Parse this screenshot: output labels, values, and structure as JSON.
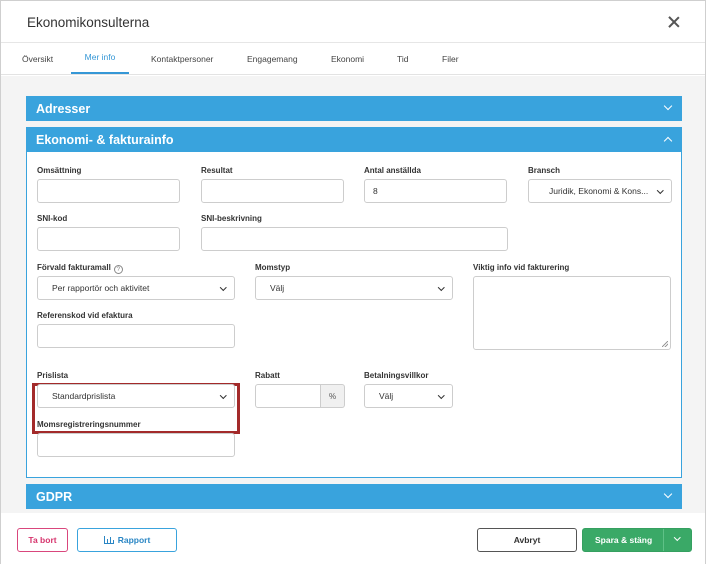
{
  "modal": {
    "title": "Ekonomikonsulterna"
  },
  "tabs": [
    {
      "label": "Översikt"
    },
    {
      "label": "Mer info"
    },
    {
      "label": "Kontaktpersoner"
    },
    {
      "label": "Engagemang"
    },
    {
      "label": "Ekonomi"
    },
    {
      "label": "Tid"
    },
    {
      "label": "Filer"
    }
  ],
  "active_tab": "Mer info",
  "sections": {
    "addresses": "Adresser",
    "economy": "Ekonomi- & fakturainfo",
    "gdpr": "GDPR"
  },
  "fields": {
    "turnover": {
      "label": "Omsättning",
      "value": ""
    },
    "result": {
      "label": "Resultat",
      "value": ""
    },
    "employees": {
      "label": "Antal anställda",
      "value": "8"
    },
    "industry": {
      "label": "Bransch",
      "value": "Juridik, Ekonomi & Kons..."
    },
    "sni_code": {
      "label": "SNI-kod",
      "value": ""
    },
    "sni_desc": {
      "label": "SNI-beskrivning",
      "value": ""
    },
    "invoice_template": {
      "label": "Förvald fakturamall",
      "value": "Per rapportör och aktivitet"
    },
    "vat_type": {
      "label": "Momstyp",
      "value": "Välj"
    },
    "invoice_info": {
      "label": "Viktig info vid fakturering",
      "value": ""
    },
    "efaktura_ref": {
      "label": "Referenskod vid efaktura",
      "value": ""
    },
    "price_list": {
      "label": "Prislista",
      "value": "Standardprislista"
    },
    "discount": {
      "label": "Rabatt",
      "value": "",
      "unit": "%"
    },
    "payment_terms": {
      "label": "Betalningsvillkor",
      "value": "Välj"
    },
    "vat_reg_no": {
      "label": "Momsregistreringsnummer",
      "value": ""
    }
  },
  "help_glyph": "?",
  "footer": {
    "delete": "Ta bort",
    "report": "Rapport",
    "cancel": "Avbryt",
    "save": "Spara & stäng"
  },
  "colors": {
    "accent": "#39a3dd",
    "save": "#3aa967",
    "delete": "#d6336c",
    "highlight": "#a32a2a"
  }
}
